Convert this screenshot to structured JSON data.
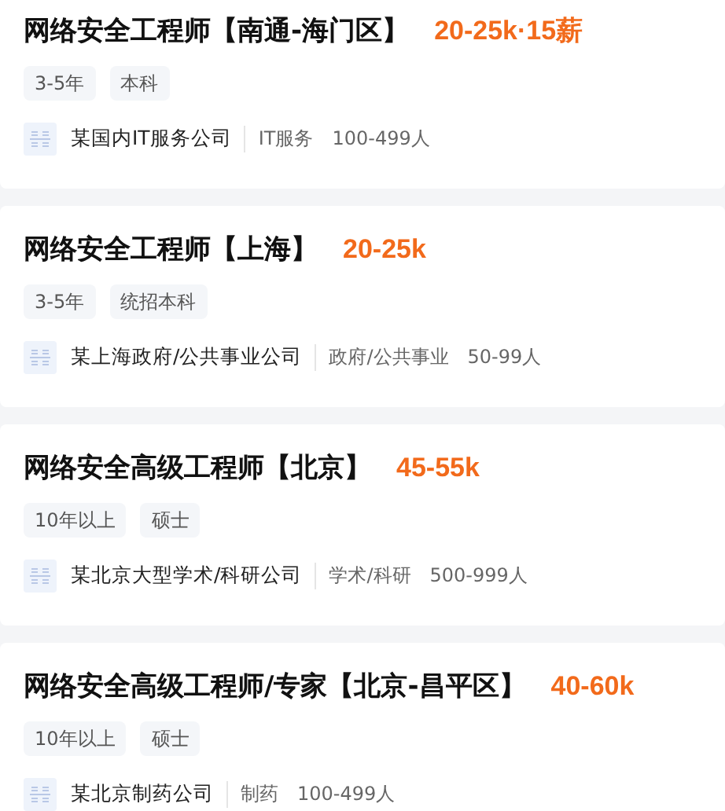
{
  "jobs": [
    {
      "title": "网络安全工程师【南通-海门区】",
      "salary": "20-25k·15薪",
      "tags": [
        "3-5年",
        "本科"
      ],
      "company": "某国内IT服务公司",
      "industry": "IT服务",
      "size": "100-499人"
    },
    {
      "title": "网络安全工程师【上海】",
      "salary": "20-25k",
      "tags": [
        "3-5年",
        "统招本科"
      ],
      "company": "某上海政府/公共事业公司",
      "industry": "政府/公共事业",
      "size": "50-99人"
    },
    {
      "title": "网络安全高级工程师【北京】",
      "salary": "45-55k",
      "tags": [
        "10年以上",
        "硕士"
      ],
      "company": "某北京大型学术/科研公司",
      "industry": "学术/科研",
      "size": "500-999人"
    },
    {
      "title": "网络安全高级工程师/专家【北京-昌平区】",
      "salary": "40-60k",
      "tags": [
        "10年以上",
        "硕士"
      ],
      "company": "某北京制药公司",
      "industry": "制药",
      "size": "100-499人"
    }
  ]
}
